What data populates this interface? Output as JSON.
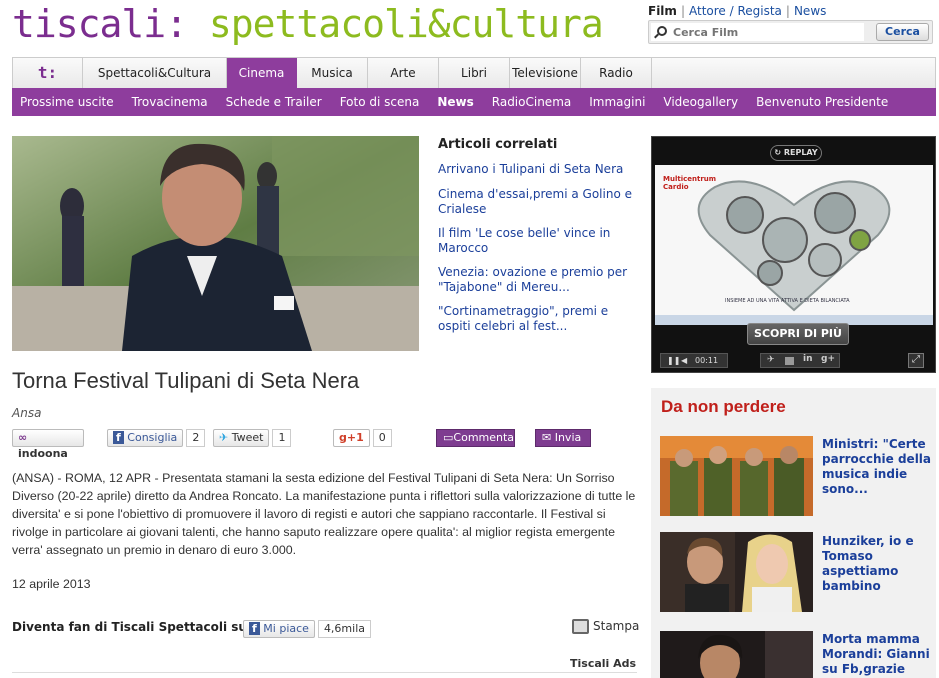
{
  "header": {
    "brand": "tiscali:",
    "section": "spettacoli&cultura"
  },
  "search": {
    "links": [
      "Film",
      "Attore / Regista",
      "News"
    ],
    "placeholder": "Cerca Film",
    "button_label": "Cerca"
  },
  "topnav": {
    "logo_label": "t:",
    "tabs": [
      "Spettacoli&Cultura",
      "Cinema",
      "Musica",
      "Arte",
      "Libri",
      "Televisione",
      "Radio"
    ],
    "active": "Cinema"
  },
  "subnav": {
    "items": [
      "Prossime uscite",
      "Trovacinema",
      "Schede e Trailer",
      "Foto di scena",
      "News",
      "RadioCinema",
      "Immagini",
      "Videogallery",
      "Benvenuto Presidente"
    ],
    "active": "News"
  },
  "related": {
    "title": "Articoli correlati",
    "items": [
      "Arrivano i Tulipani di Seta Nera",
      "Cinema d'essai,premi a Golino e Crialese",
      "Il film 'Le cose belle' vince in Marocco",
      "Venezia: ovazione e premio per \"Tajabone\" di Mereu...",
      "\"Cortinametraggio\", premi e ospiti celebri al fest..."
    ]
  },
  "article": {
    "title": "Torna Festival Tulipani di Seta Nera",
    "source": "Ansa",
    "body": "(ANSA) - ROMA, 12 APR - Presentata stamani la sesta edizione del Festival Tulipani di Seta Nera: Un Sorriso Diverso (20-22 aprile) diretto da Andrea Roncato. La manifestazione punta i riflettori sulla valorizzazione di tutte le diversita' e si pone l'obiettivo di promuovere il lavoro di registi e autori che sappiano raccontarle. Il Festival si rivolge in particolare ai giovani talenti, che hanno saputo realizzare opere qualita': al miglior regista emergente verra' assegnato un premio in denaro di euro 3.000.",
    "date": "12 aprile 2013"
  },
  "social": {
    "indoona": "indoona",
    "consiglia": "Consiglia",
    "consiglia_count": "2",
    "tweet": "Tweet",
    "tweet_count": "1",
    "gplus": "+1",
    "gplus_count": "0",
    "commenta": "Commenta",
    "invia": "Invia"
  },
  "fan": {
    "text": "Diventa fan di Tiscali Spettacoli su FB",
    "like": "Mi piace",
    "like_count": "4,6mila"
  },
  "print_label": "Stampa",
  "ads_label": "Tiscali Ads",
  "video": {
    "replay": "REPLAY",
    "discover": "SCOPRI DI PIÙ",
    "time": "00:11",
    "ad_brand": "Multicentrum Cardio",
    "ad_tagline": "INSIEME AD UNA VITA ATTIVA E DIETA BILANCIATA"
  },
  "da_non_perdere": {
    "title": "Da non perdere",
    "items": [
      "Ministri: \"Certe parrocchie della musica indie sono...",
      "Hunziker, io e Tomaso aspettiamo bambino",
      "Morta mamma Morandi: Gianni su Fb,grazie"
    ]
  },
  "colors": {
    "brand_purple": "#7b2d8f",
    "nav_purple": "#8e3d9d",
    "brand_green": "#8dbb1f",
    "link_blue": "#1b3f9a",
    "accent_red": "#c0201b"
  }
}
